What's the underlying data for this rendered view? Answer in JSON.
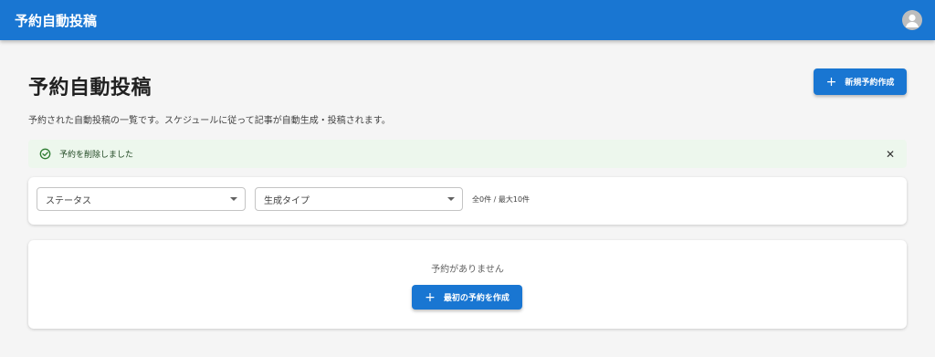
{
  "appbar": {
    "title": "予約自動投稿",
    "avatar_icon": "account-circle-icon",
    "color": "#1976d2"
  },
  "page": {
    "title": "予約自動投稿",
    "description": "予約された自動投稿の一覧です。スケジュールに従って記事が自動生成・投稿されます。",
    "new_button": {
      "icon": "plus-icon",
      "label": "新規予約作成"
    }
  },
  "alert": {
    "icon": "check-circle-icon",
    "message": "予約を削除しました",
    "close_icon": "close-icon",
    "background": "#edf7ed"
  },
  "filters": {
    "status_select": {
      "value": "ステータス"
    },
    "type_select": {
      "value": "生成タイプ"
    },
    "count_text": "全0件 / 最大10件"
  },
  "empty_state": {
    "message": "予約がありません",
    "button": {
      "icon": "plus-icon",
      "label": "最初の予約を作成"
    }
  }
}
